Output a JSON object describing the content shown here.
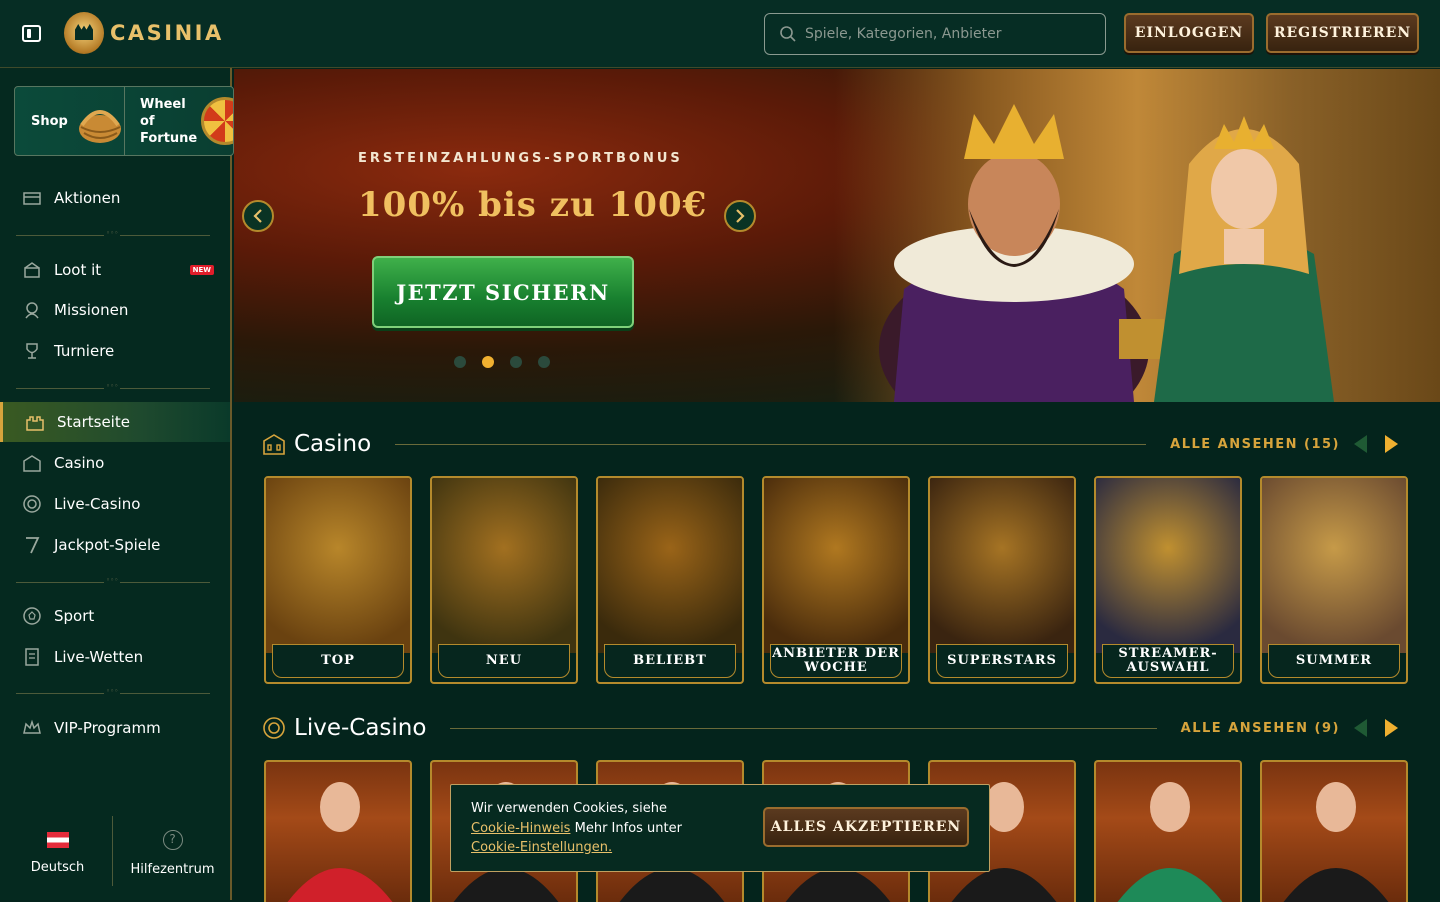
{
  "header": {
    "brand": "CASINIA",
    "search_placeholder": "Spiele, Kategorien, Anbieter",
    "login_label": "EINLOGGEN",
    "register_label": "REGISTRIEREN"
  },
  "sidebar": {
    "promo": {
      "shop": "Shop",
      "wheel": "Wheel of Fortune"
    },
    "items": [
      {
        "label": "Aktionen",
        "icon": "gift-card-icon"
      },
      {
        "label": "Loot it",
        "icon": "loot-box-icon",
        "badge": "NEW"
      },
      {
        "label": "Missionen",
        "icon": "medal-icon"
      },
      {
        "label": "Turniere",
        "icon": "trophy-icon"
      },
      {
        "label": "Startseite",
        "icon": "castle-icon",
        "active": true
      },
      {
        "label": "Casino",
        "icon": "casino-building-icon"
      },
      {
        "label": "Live-Casino",
        "icon": "chip-icon"
      },
      {
        "label": "Jackpot-Spiele",
        "icon": "seven-icon"
      },
      {
        "label": "Sport",
        "icon": "football-icon"
      },
      {
        "label": "Live-Wetten",
        "icon": "betslip-icon"
      },
      {
        "label": "VIP-Programm",
        "icon": "crown-icon"
      }
    ],
    "footer": {
      "language": "Deutsch",
      "help": "Hilfezentrum"
    }
  },
  "banner": {
    "subtitle": "ERSTEINZAHLUNGS-SPORTBONUS",
    "title": "100% bis zu 100€",
    "cta": "JETZT SICHERN",
    "slide_count": 4,
    "active_slide": 2
  },
  "casino_section": {
    "title": "Casino",
    "view_all": "ALLE ANSEHEN (15)",
    "categories": [
      {
        "label": "TOP",
        "colors": [
          "#b8862a",
          "#6a4210"
        ]
      },
      {
        "label": "NEU",
        "colors": [
          "#a27020",
          "#3f3410"
        ]
      },
      {
        "label": "BELIEBT",
        "colors": [
          "#9a6418",
          "#3a2a0c"
        ]
      },
      {
        "label": "ANBIETER DER WOCHE",
        "colors": [
          "#b07820",
          "#4a2c0c"
        ]
      },
      {
        "label": "SUPERSTARS",
        "colors": [
          "#a67424",
          "#3a2410"
        ]
      },
      {
        "label": "STREAMER-AUSWAHL",
        "colors": [
          "#c09030",
          "#2a2a40"
        ]
      },
      {
        "label": "SUMMER",
        "colors": [
          "#c69a48",
          "#6a4a30"
        ]
      }
    ]
  },
  "live_section": {
    "title": "Live-Casino",
    "view_all": "ALLE ANSEHEN (9)",
    "tables": 7
  },
  "cookie": {
    "text1": "Wir verwenden Cookies, siehe",
    "link1": "Cookie-Hinweis",
    "text2": "Mehr Infos unter",
    "link2": "Cookie-Einstellungen.",
    "accept": "ALLES AKZEPTIEREN"
  }
}
